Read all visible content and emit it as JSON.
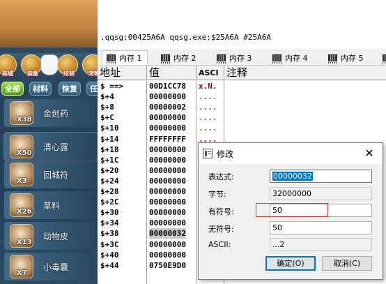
{
  "game": {
    "icons": [
      {
        "label": "商城",
        "icon": "mall-icon"
      },
      {
        "label": "装备",
        "icon": "equipment-icon"
      },
      {
        "label": "炫装",
        "icon": "fashion-icon"
      },
      {
        "label": "宠物",
        "icon": "pet-icon"
      }
    ],
    "tabs": [
      "全部",
      "材料",
      "恢复",
      "任"
    ],
    "items": [
      {
        "qty": "X38",
        "name": "金创药",
        "icon": "medicine-bottle-icon"
      },
      {
        "qty": "X50",
        "name": "清心露",
        "icon": "potion-bottle-icon"
      },
      {
        "qty": "X3",
        "name": "回城符",
        "icon": "scroll-icon"
      },
      {
        "qty": "X26",
        "name": "草料",
        "icon": "hay-icon"
      },
      {
        "qty": "X13",
        "name": "动物皮",
        "icon": "hide-icon"
      },
      {
        "qty": "X7",
        "name": "小毒囊",
        "icon": "pouch-icon"
      }
    ]
  },
  "debugger": {
    "address_line": ".qqsg:00425A6A qqsg.exe:$25A6A #25A6A",
    "tabs": [
      "内存 1",
      "内存 2",
      "内存 3",
      "内存 4",
      "内存 5"
    ],
    "columns": {
      "address": "地址",
      "value": "值",
      "ascii": "ASCI",
      "comment": "注释"
    },
    "rows": [
      {
        "addr": "$ ==>",
        "value": "00D1CC78",
        "ascii": "x.N.",
        "hi": true
      },
      {
        "addr": "$+4",
        "value": "00000000",
        "ascii": "...."
      },
      {
        "addr": "$+8",
        "value": "00000002",
        "ascii": "...."
      },
      {
        "addr": "$+C",
        "value": "00000000",
        "ascii": "...."
      },
      {
        "addr": "$+10",
        "value": "00000000",
        "ascii": "...."
      },
      {
        "addr": "$+14",
        "value": "FFFFFFFF",
        "ascii": "....",
        "hi": true
      },
      {
        "addr": "$+18",
        "value": "00000000",
        "ascii": ""
      },
      {
        "addr": "$+1C",
        "value": "00000000",
        "ascii": ""
      },
      {
        "addr": "$+20",
        "value": "00000000",
        "ascii": ""
      },
      {
        "addr": "$+24",
        "value": "00000000",
        "ascii": ""
      },
      {
        "addr": "$+28",
        "value": "00000000",
        "ascii": ""
      },
      {
        "addr": "$+2C",
        "value": "00000000",
        "ascii": ""
      },
      {
        "addr": "$+30",
        "value": "00000000",
        "ascii": ""
      },
      {
        "addr": "$+34",
        "value": "00000000",
        "ascii": ""
      },
      {
        "addr": "$+38",
        "value": "00000032",
        "ascii": "",
        "selected": true
      },
      {
        "addr": "$+3C",
        "value": "00000000",
        "ascii": ""
      },
      {
        "addr": "$+40",
        "value": "00000000",
        "ascii": ""
      },
      {
        "addr": "$+44",
        "value": "0750E9D0",
        "ascii": ""
      }
    ]
  },
  "dialog": {
    "title": "修改",
    "close": "✕",
    "fields": [
      {
        "label": "表达式:",
        "value": "00000032"
      },
      {
        "label": "字节:",
        "value": "32000000"
      },
      {
        "label": "有符号:",
        "value": "50"
      },
      {
        "label": "无符号:",
        "value": "50"
      },
      {
        "label": "ASCII:",
        "value": "...2"
      }
    ],
    "ok": "确定(O)",
    "cancel": "取消(C)"
  }
}
